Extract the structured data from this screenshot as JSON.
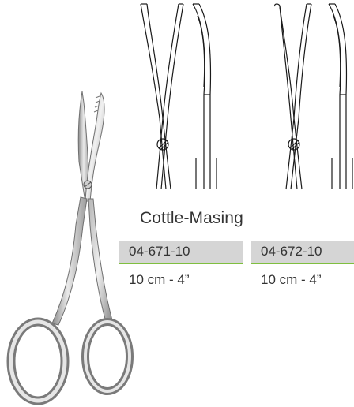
{
  "product": {
    "name": "Cottle-Masing",
    "variants": [
      {
        "code": "04-671-10",
        "size": "10 cm - 4”"
      },
      {
        "code": "04-672-10",
        "size": "10 cm - 4”"
      }
    ]
  },
  "colors": {
    "code_background": "#d5d5d5",
    "accent_underline": "#7fbf3f",
    "text": "#333333"
  }
}
